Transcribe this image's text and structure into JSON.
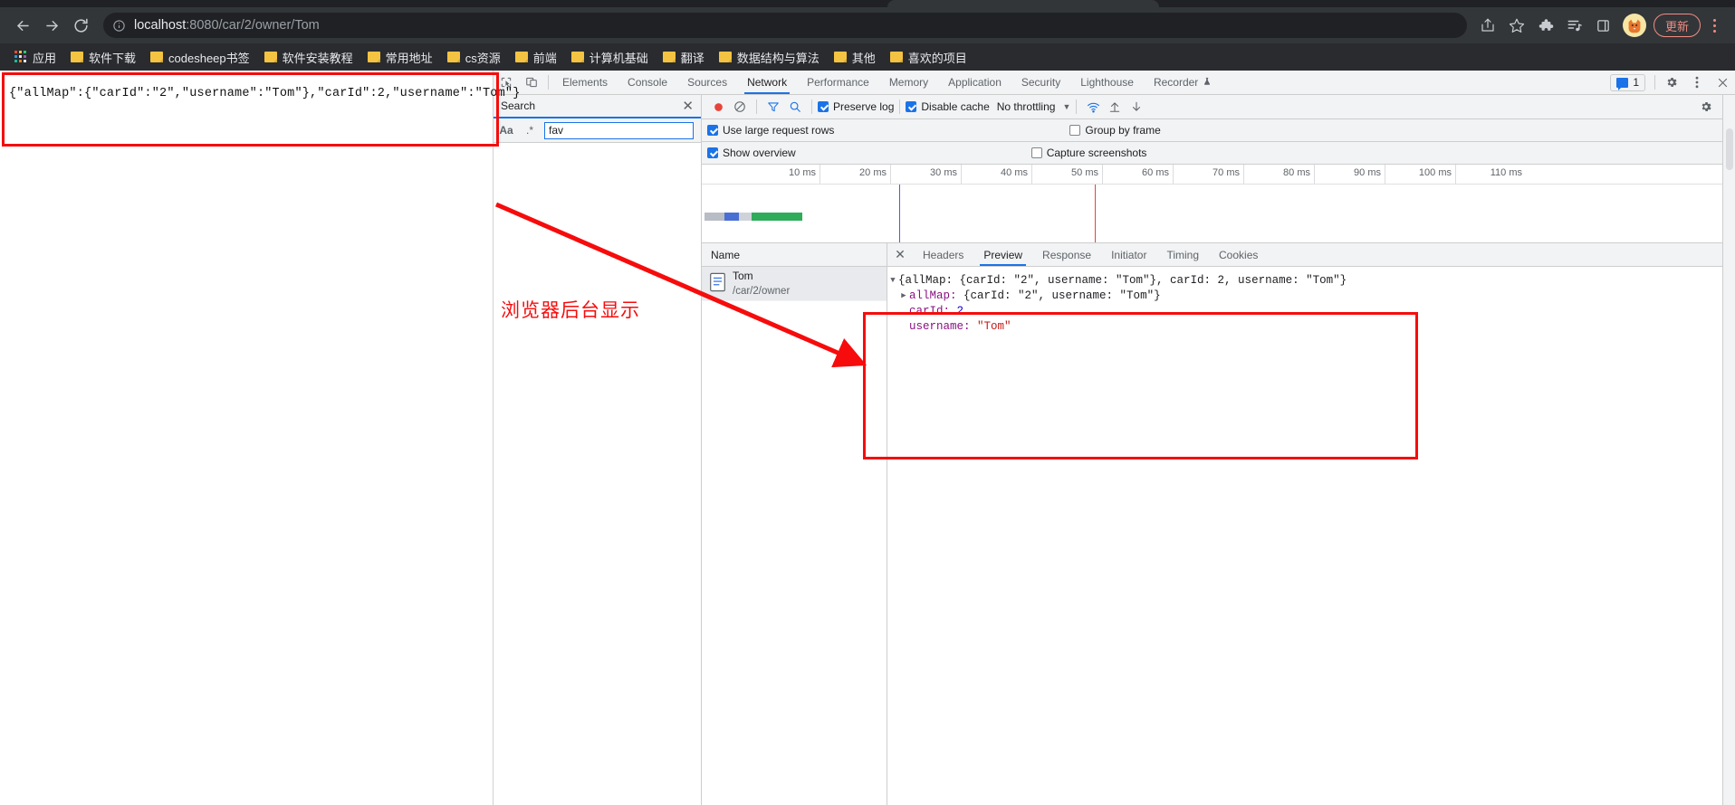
{
  "browser": {
    "url_host": "localhost",
    "url_path": ":8080/car/2/owner/Tom",
    "update_label": "更新",
    "nav": {
      "back": "back-arrow",
      "forward": "forward-arrow",
      "reload": "reload"
    },
    "bookmarks": [
      {
        "label": "应用",
        "icon": "apps-grid"
      },
      {
        "label": "软件下载",
        "icon": "folder"
      },
      {
        "label": "codesheep书签",
        "icon": "folder"
      },
      {
        "label": "软件安装教程",
        "icon": "folder"
      },
      {
        "label": "常用地址",
        "icon": "folder"
      },
      {
        "label": "cs资源",
        "icon": "folder"
      },
      {
        "label": "前端",
        "icon": "folder"
      },
      {
        "label": "计算机基础",
        "icon": "folder"
      },
      {
        "label": "翻译",
        "icon": "folder"
      },
      {
        "label": "数据结构与算法",
        "icon": "folder"
      },
      {
        "label": "其他",
        "icon": "folder"
      },
      {
        "label": "喜欢的项目",
        "icon": "folder"
      }
    ]
  },
  "page": {
    "response_text": "{\"allMap\":{\"carId\":\"2\",\"username\":\"Tom\"},\"carId\":2,\"username\":\"Tom\"}"
  },
  "annotation": {
    "label": "浏览器后台显示",
    "color": "#f60c0c"
  },
  "devtools": {
    "tabs": [
      {
        "label": "Elements",
        "active": false
      },
      {
        "label": "Console",
        "active": false
      },
      {
        "label": "Sources",
        "active": false
      },
      {
        "label": "Network",
        "active": true
      },
      {
        "label": "Performance",
        "active": false
      },
      {
        "label": "Memory",
        "active": false
      },
      {
        "label": "Application",
        "active": false
      },
      {
        "label": "Security",
        "active": false
      },
      {
        "label": "Lighthouse",
        "active": false
      },
      {
        "label": "Recorder",
        "active": false
      }
    ],
    "issues_count": "1",
    "search": {
      "title": "Search",
      "match_case_label": "Aa",
      "regex_label": ".*",
      "query": "fav"
    },
    "network_toolbar": {
      "preserve_log": "Preserve log",
      "disable_cache": "Disable cache",
      "throttling": "No throttling",
      "use_large_request_rows": "Use large request rows",
      "group_by_frame": "Group by frame",
      "show_overview": "Show overview",
      "capture_screenshots": "Capture screenshots"
    },
    "timeline_ticks": [
      "10 ms",
      "20 ms",
      "30 ms",
      "40 ms",
      "50 ms",
      "60 ms",
      "70 ms",
      "80 ms",
      "90 ms",
      "100 ms",
      "110 ms"
    ],
    "requests": {
      "column_header": "Name",
      "rows": [
        {
          "name": "Tom",
          "path": "/car/2/owner"
        }
      ]
    },
    "detail_tabs": [
      {
        "label": "Headers",
        "active": false
      },
      {
        "label": "Preview",
        "active": true
      },
      {
        "label": "Response",
        "active": false
      },
      {
        "label": "Initiator",
        "active": false
      },
      {
        "label": "Timing",
        "active": false
      },
      {
        "label": "Cookies",
        "active": false
      }
    ],
    "preview": {
      "root_summary_prefix": "{allMap: {carId: ",
      "line0": "{allMap: {carId: \"2\", username: \"Tom\"}, carId: 2, username: \"Tom\"}",
      "line1_key": "allMap:",
      "line1_val": "{carId: \"2\", username: \"Tom\"}",
      "line2_key": "carId:",
      "line2_val": "2",
      "line3_key": "username:",
      "line3_val": "\"Tom\""
    }
  }
}
